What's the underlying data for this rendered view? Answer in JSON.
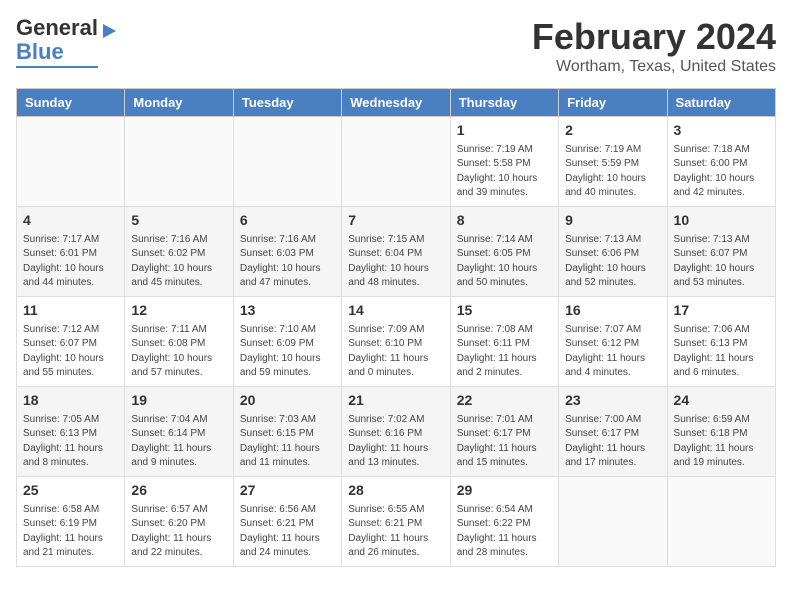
{
  "header": {
    "logo_general": "General",
    "logo_blue": "Blue",
    "main_title": "February 2024",
    "subtitle": "Wortham, Texas, United States"
  },
  "days_of_week": [
    "Sunday",
    "Monday",
    "Tuesday",
    "Wednesday",
    "Thursday",
    "Friday",
    "Saturday"
  ],
  "weeks": [
    [
      {
        "day": "",
        "info": ""
      },
      {
        "day": "",
        "info": ""
      },
      {
        "day": "",
        "info": ""
      },
      {
        "day": "",
        "info": ""
      },
      {
        "day": "1",
        "info": "Sunrise: 7:19 AM\nSunset: 5:58 PM\nDaylight: 10 hours\nand 39 minutes."
      },
      {
        "day": "2",
        "info": "Sunrise: 7:19 AM\nSunset: 5:59 PM\nDaylight: 10 hours\nand 40 minutes."
      },
      {
        "day": "3",
        "info": "Sunrise: 7:18 AM\nSunset: 6:00 PM\nDaylight: 10 hours\nand 42 minutes."
      }
    ],
    [
      {
        "day": "4",
        "info": "Sunrise: 7:17 AM\nSunset: 6:01 PM\nDaylight: 10 hours\nand 44 minutes."
      },
      {
        "day": "5",
        "info": "Sunrise: 7:16 AM\nSunset: 6:02 PM\nDaylight: 10 hours\nand 45 minutes."
      },
      {
        "day": "6",
        "info": "Sunrise: 7:16 AM\nSunset: 6:03 PM\nDaylight: 10 hours\nand 47 minutes."
      },
      {
        "day": "7",
        "info": "Sunrise: 7:15 AM\nSunset: 6:04 PM\nDaylight: 10 hours\nand 48 minutes."
      },
      {
        "day": "8",
        "info": "Sunrise: 7:14 AM\nSunset: 6:05 PM\nDaylight: 10 hours\nand 50 minutes."
      },
      {
        "day": "9",
        "info": "Sunrise: 7:13 AM\nSunset: 6:06 PM\nDaylight: 10 hours\nand 52 minutes."
      },
      {
        "day": "10",
        "info": "Sunrise: 7:13 AM\nSunset: 6:07 PM\nDaylight: 10 hours\nand 53 minutes."
      }
    ],
    [
      {
        "day": "11",
        "info": "Sunrise: 7:12 AM\nSunset: 6:07 PM\nDaylight: 10 hours\nand 55 minutes."
      },
      {
        "day": "12",
        "info": "Sunrise: 7:11 AM\nSunset: 6:08 PM\nDaylight: 10 hours\nand 57 minutes."
      },
      {
        "day": "13",
        "info": "Sunrise: 7:10 AM\nSunset: 6:09 PM\nDaylight: 10 hours\nand 59 minutes."
      },
      {
        "day": "14",
        "info": "Sunrise: 7:09 AM\nSunset: 6:10 PM\nDaylight: 11 hours\nand 0 minutes."
      },
      {
        "day": "15",
        "info": "Sunrise: 7:08 AM\nSunset: 6:11 PM\nDaylight: 11 hours\nand 2 minutes."
      },
      {
        "day": "16",
        "info": "Sunrise: 7:07 AM\nSunset: 6:12 PM\nDaylight: 11 hours\nand 4 minutes."
      },
      {
        "day": "17",
        "info": "Sunrise: 7:06 AM\nSunset: 6:13 PM\nDaylight: 11 hours\nand 6 minutes."
      }
    ],
    [
      {
        "day": "18",
        "info": "Sunrise: 7:05 AM\nSunset: 6:13 PM\nDaylight: 11 hours\nand 8 minutes."
      },
      {
        "day": "19",
        "info": "Sunrise: 7:04 AM\nSunset: 6:14 PM\nDaylight: 11 hours\nand 9 minutes."
      },
      {
        "day": "20",
        "info": "Sunrise: 7:03 AM\nSunset: 6:15 PM\nDaylight: 11 hours\nand 11 minutes."
      },
      {
        "day": "21",
        "info": "Sunrise: 7:02 AM\nSunset: 6:16 PM\nDaylight: 11 hours\nand 13 minutes."
      },
      {
        "day": "22",
        "info": "Sunrise: 7:01 AM\nSunset: 6:17 PM\nDaylight: 11 hours\nand 15 minutes."
      },
      {
        "day": "23",
        "info": "Sunrise: 7:00 AM\nSunset: 6:17 PM\nDaylight: 11 hours\nand 17 minutes."
      },
      {
        "day": "24",
        "info": "Sunrise: 6:59 AM\nSunset: 6:18 PM\nDaylight: 11 hours\nand 19 minutes."
      }
    ],
    [
      {
        "day": "25",
        "info": "Sunrise: 6:58 AM\nSunset: 6:19 PM\nDaylight: 11 hours\nand 21 minutes."
      },
      {
        "day": "26",
        "info": "Sunrise: 6:57 AM\nSunset: 6:20 PM\nDaylight: 11 hours\nand 22 minutes."
      },
      {
        "day": "27",
        "info": "Sunrise: 6:56 AM\nSunset: 6:21 PM\nDaylight: 11 hours\nand 24 minutes."
      },
      {
        "day": "28",
        "info": "Sunrise: 6:55 AM\nSunset: 6:21 PM\nDaylight: 11 hours\nand 26 minutes."
      },
      {
        "day": "29",
        "info": "Sunrise: 6:54 AM\nSunset: 6:22 PM\nDaylight: 11 hours\nand 28 minutes."
      },
      {
        "day": "",
        "info": ""
      },
      {
        "day": "",
        "info": ""
      }
    ]
  ]
}
